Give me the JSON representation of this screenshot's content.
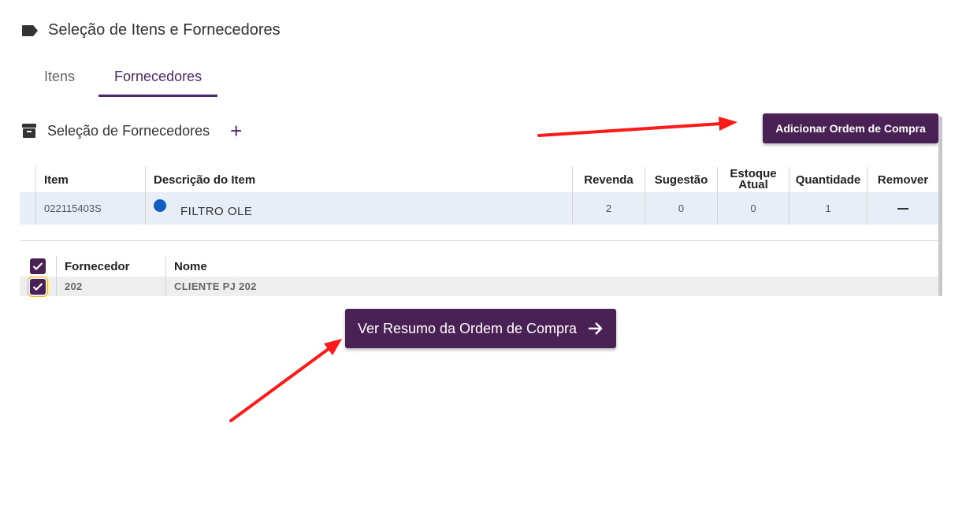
{
  "header": {
    "title": "Seleção de Itens e Fornecedores",
    "icon": "label-icon"
  },
  "tabs": [
    {
      "label": "Itens",
      "active": false
    },
    {
      "label": "Fornecedores",
      "active": true
    }
  ],
  "section": {
    "title": "Seleção de Fornecedores",
    "icon": "archive-icon",
    "add_label": "+"
  },
  "add_order_button": "Adicionar Ordem de Compra",
  "items_table": {
    "columns": [
      "Item",
      "Descrição do Item",
      "Revenda",
      "Sugestão",
      "Estoque",
      "Atual",
      "Quantidade",
      "Remover"
    ],
    "rows": [
      {
        "item": "022115403S",
        "descricao": "FILTRO OLE",
        "revenda": "2",
        "sugestao": "0",
        "estoque_atual": "0",
        "quantidade": "1",
        "status_color": "#0f5fc2"
      }
    ]
  },
  "suppliers_table": {
    "columns": [
      "Fornecedor",
      "Nome"
    ],
    "rows": [
      {
        "fornecedor": "202",
        "nome": "CLIENTE PJ 202",
        "checked": true
      }
    ],
    "all_checked": true
  },
  "summary_button": "Ver Resumo da Ordem de Compra",
  "colors": {
    "primary": "#4a2154",
    "row_highlight": "#e8eef8",
    "status_dot": "#0f5fc2",
    "annotation": "#ff0000"
  }
}
